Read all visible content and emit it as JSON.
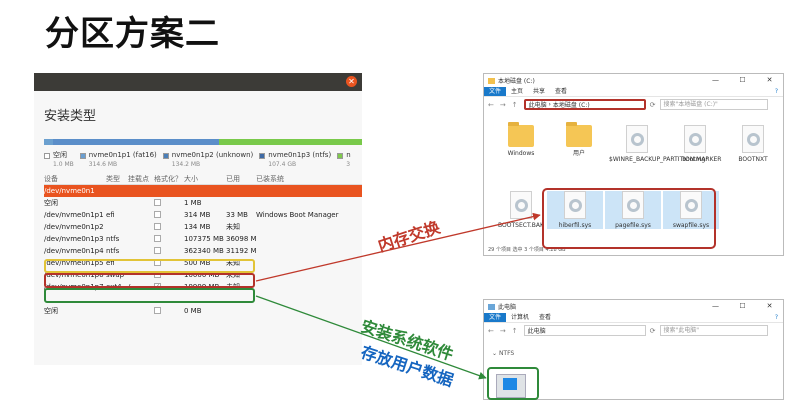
{
  "slide": {
    "title": "分区方案二",
    "watermark": ""
  },
  "installer": {
    "heading": "安装类型",
    "bar_colors": [
      "#6ba0cf",
      "#5b8ec9",
      "#79c94a",
      "#d0d0d0"
    ],
    "legend": [
      {
        "name": "空闲",
        "size": "1.0 MB",
        "color": "#ffffff"
      },
      {
        "name": "nvme0n1p1 (fat16)",
        "size": "314.6 MB",
        "color": "#6a9ed0"
      },
      {
        "name": "nvme0n1p2 (unknown)",
        "size": "134.2 MB",
        "color": "#4b7fb8"
      },
      {
        "name": "nvme0n1p3 (ntfs)",
        "size": "107.4 GB",
        "color": "#3e6aa5"
      },
      {
        "name": "n",
        "size": "3",
        "color": "#7fc94c"
      }
    ],
    "columns": [
      "设备",
      "类型",
      "挂载点",
      "格式化？",
      "大小",
      "已用",
      "已装系统"
    ],
    "rows": [
      {
        "dev": "/dev/nvme0n1",
        "type": "",
        "mount": "",
        "fmt": "",
        "size": "",
        "used": "",
        "os": "",
        "selected": true
      },
      {
        "dev": "空闲",
        "type": "",
        "mount": "",
        "fmt": "",
        "size": "1 MB",
        "used": "",
        "os": ""
      },
      {
        "dev": "/dev/nvme0n1p1",
        "type": "efi",
        "mount": "",
        "fmt": "",
        "size": "314 MB",
        "used": "33 MB",
        "os": "Windows Boot Manager"
      },
      {
        "dev": "/dev/nvme0n1p2",
        "type": "",
        "mount": "",
        "fmt": "",
        "size": "134 MB",
        "used": "未知",
        "os": ""
      },
      {
        "dev": "/dev/nvme0n1p3",
        "type": "ntfs",
        "mount": "",
        "fmt": "",
        "size": "107375 MB",
        "used": "36098 MB",
        "os": ""
      },
      {
        "dev": "/dev/nvme0n1p4",
        "type": "ntfs",
        "mount": "",
        "fmt": "",
        "size": "362340 MB",
        "used": "31192 MB",
        "os": ""
      },
      {
        "dev": "/dev/nvme0n1p5",
        "type": "efi",
        "mount": "",
        "fmt": "",
        "size": "500 MB",
        "used": "未知",
        "os": ""
      },
      {
        "dev": "/dev/nvme0n1p6",
        "type": "swap",
        "mount": "",
        "fmt": "",
        "size": "10000 MB",
        "used": "未知",
        "os": ""
      },
      {
        "dev": "/dev/nvme0n1p7",
        "type": "ext4",
        "mount": "/",
        "fmt": "✓",
        "size": "19999 MB",
        "used": "未知",
        "os": ""
      },
      {
        "dev": "",
        "type": "",
        "mount": "",
        "fmt": "",
        "size": "",
        "used": "",
        "os": ""
      },
      {
        "dev": "空闲",
        "type": "",
        "mount": "",
        "fmt": "",
        "size": "0 MB",
        "used": "",
        "os": ""
      }
    ]
  },
  "explorer_c": {
    "title": "本地磁盘 (C:)",
    "ribbon": [
      "文件",
      "主页",
      "共享",
      "查看"
    ],
    "crumbs": [
      "此电脑",
      "本地磁盘 (C:)"
    ],
    "search_placeholder": "搜索\"本地磁盘 (C:)\"",
    "files": [
      {
        "name": "Windows",
        "kind": "folder"
      },
      {
        "name": "用户",
        "kind": "folder"
      },
      {
        "name": "$WINRE_BACKUP_PARTITION.MARKER",
        "kind": "doc"
      },
      {
        "name": "bootmgr",
        "kind": "doc"
      },
      {
        "name": "BOOTNXT",
        "kind": "doc"
      },
      {
        "name": "BOOTSECT.BAK",
        "kind": "doc"
      },
      {
        "name": "hiberfil.sys",
        "kind": "sys"
      },
      {
        "name": "pagefile.sys",
        "kind": "sys"
      },
      {
        "name": "swapfile.sys",
        "kind": "sys"
      }
    ],
    "status": "29 个项目  选中 3 个项目  4.28 GB"
  },
  "explorer_pc": {
    "title": "此电脑",
    "ribbon": [
      "文件",
      "计算机",
      "查看"
    ],
    "crumbs": [
      "此电脑"
    ],
    "search_placeholder": "搜索\"此电脑\"",
    "section": "NTFS"
  },
  "annotations": {
    "swap_label": "内存交换",
    "install_label": "安装系统软件",
    "data_label": "存放用户数据",
    "colors": {
      "red": "#c0392b",
      "green": "#2f8a3a",
      "blue": "#1565c0",
      "yellow": "#e2c437"
    }
  }
}
